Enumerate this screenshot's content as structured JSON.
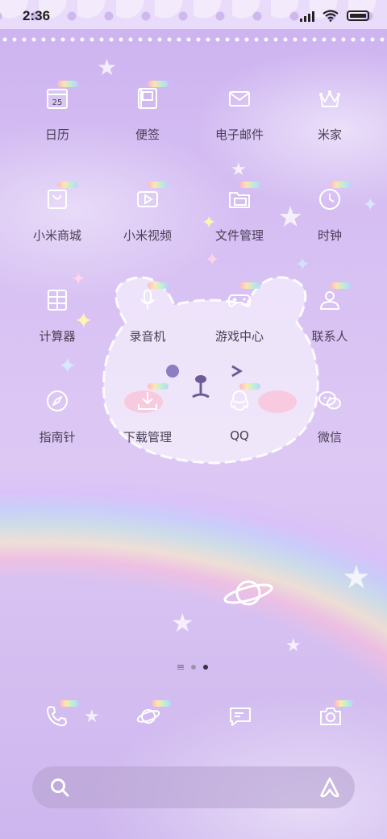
{
  "status_bar": {
    "time": "2:36"
  },
  "apps": [
    {
      "id": "calendar",
      "label": "日历",
      "icon": "calendar-icon",
      "icon_text": "25"
    },
    {
      "id": "notes",
      "label": "便签",
      "icon": "notes-icon"
    },
    {
      "id": "email",
      "label": "电子邮件",
      "icon": "mail-icon"
    },
    {
      "id": "mijia",
      "label": "米家",
      "icon": "crown-icon"
    },
    {
      "id": "mi-store",
      "label": "小米商城",
      "icon": "shopping-bag-icon"
    },
    {
      "id": "mi-video",
      "label": "小米视频",
      "icon": "video-icon"
    },
    {
      "id": "file-manager",
      "label": "文件管理",
      "icon": "folder-icon"
    },
    {
      "id": "clock",
      "label": "时钟",
      "icon": "clock-icon"
    },
    {
      "id": "calculator",
      "label": "计算器",
      "icon": "calculator-icon"
    },
    {
      "id": "recorder",
      "label": "录音机",
      "icon": "microphone-icon"
    },
    {
      "id": "game-center",
      "label": "游戏中心",
      "icon": "gamepad-icon"
    },
    {
      "id": "contacts",
      "label": "联系人",
      "icon": "person-icon"
    },
    {
      "id": "compass",
      "label": "指南针",
      "icon": "compass-icon"
    },
    {
      "id": "downloads",
      "label": "下载管理",
      "icon": "download-icon"
    },
    {
      "id": "qq",
      "label": "QQ",
      "icon": "qq-penguin-icon"
    },
    {
      "id": "wechat",
      "label": "微信",
      "icon": "wechat-icon"
    }
  ],
  "page_indicator": {
    "pages": 2,
    "active_index": 1
  },
  "dock": [
    {
      "id": "phone",
      "icon": "phone-icon"
    },
    {
      "id": "browser",
      "icon": "planet-icon"
    },
    {
      "id": "messages",
      "icon": "message-icon"
    },
    {
      "id": "camera",
      "icon": "camera-icon"
    }
  ],
  "search_bar": {
    "left_icon": "search-icon",
    "right_icon": "assistant-icon"
  },
  "colors": {
    "background": "#d7c0f3",
    "label_text": "#4a3f55",
    "icon_stroke": "#ffffff"
  }
}
